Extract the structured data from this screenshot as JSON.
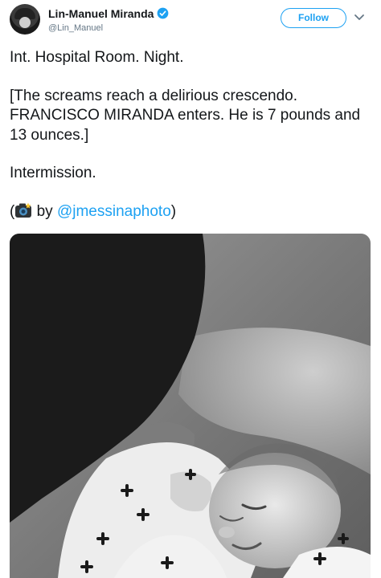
{
  "header": {
    "display_name": "Lin-Manuel Miranda",
    "handle": "@Lin_Manuel",
    "follow_label": "Follow"
  },
  "tweet": {
    "line1": "Int. Hospital Room. Night.",
    "line2": "[The screams reach a delirious crescendo. FRANCISCO MIRANDA enters. He is 7 pounds and 13 ounces.]",
    "line3": "Intermission.",
    "credit_open": "(",
    "credit_by": " by ",
    "credit_mention": "@jmessinaphoto",
    "credit_close": ")"
  },
  "colors": {
    "accent": "#1da1f2",
    "text": "#14171a",
    "muted": "#657786"
  },
  "icons": [
    "verified-badge-icon",
    "chevron-down-icon",
    "camera-emoji-icon"
  ]
}
